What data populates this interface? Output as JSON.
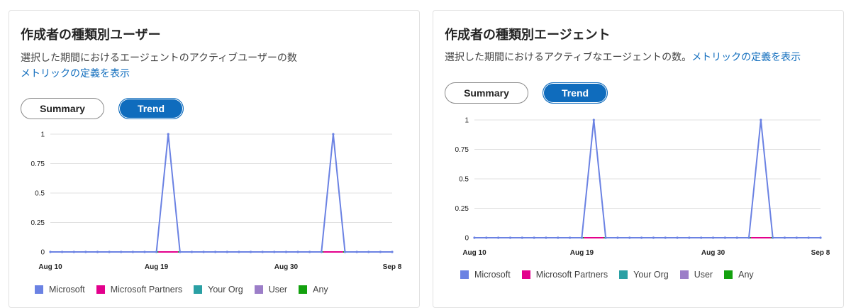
{
  "cards": [
    {
      "title": "作成者の種類別ユーザー",
      "description": "選択した期間におけるエージェントのアクティブユーザーの数",
      "link": "メトリックの定義を表示",
      "summary_label": "Summary",
      "trend_label": "Trend"
    },
    {
      "title": "作成者の種類別エージェント",
      "description": "選択した期間におけるアクティブなエージェントの数。",
      "link": "メトリックの定義を表示",
      "summary_label": "Summary",
      "trend_label": "Trend"
    }
  ],
  "legend": [
    {
      "name": "Microsoft",
      "color": "#6b82e3"
    },
    {
      "name": "Microsoft Partners",
      "color": "#e3008c"
    },
    {
      "name": "Your Org",
      "color": "#2aa0a4"
    },
    {
      "name": "User",
      "color": "#9c7ec8"
    },
    {
      "name": "Any",
      "color": "#13a10e"
    }
  ],
  "chart_data": [
    {
      "type": "line",
      "title": "作成者の種類別ユーザー",
      "x": [
        "Aug 10",
        "Aug 11",
        "Aug 12",
        "Aug 13",
        "Aug 14",
        "Aug 15",
        "Aug 16",
        "Aug 17",
        "Aug 18",
        "Aug 19",
        "Aug 20",
        "Aug 21",
        "Aug 22",
        "Aug 23",
        "Aug 24",
        "Aug 25",
        "Aug 26",
        "Aug 27",
        "Aug 28",
        "Aug 29",
        "Aug 30",
        "Aug 31",
        "Sep 1",
        "Sep 2",
        "Sep 3",
        "Sep 4",
        "Sep 5",
        "Sep 6",
        "Sep 7",
        "Sep 8"
      ],
      "x_tick_labels": [
        "Aug 10",
        "Aug 19",
        "Aug 30",
        "Sep 8"
      ],
      "y_ticks": [
        "0",
        "0.25",
        "0.5",
        "0.75",
        "1"
      ],
      "ylim": [
        0,
        1
      ],
      "series": [
        {
          "name": "Microsoft",
          "values": [
            0,
            0,
            0,
            0,
            0,
            0,
            0,
            0,
            0,
            0,
            1,
            0,
            0,
            0,
            0,
            0,
            0,
            0,
            0,
            0,
            0,
            0,
            0,
            0,
            1,
            0,
            0,
            0,
            0,
            0
          ]
        },
        {
          "name": "Microsoft Partners",
          "values": [
            0,
            0,
            0,
            0,
            0,
            0,
            0,
            0,
            0,
            0,
            0,
            0,
            0,
            0,
            0,
            0,
            0,
            0,
            0,
            0,
            0,
            0,
            0,
            0,
            0,
            0,
            0,
            0,
            0,
            0
          ]
        },
        {
          "name": "Your Org",
          "values": [
            0,
            0,
            0,
            0,
            0,
            0,
            0,
            0,
            0,
            0,
            0,
            0,
            0,
            0,
            0,
            0,
            0,
            0,
            0,
            0,
            0,
            0,
            0,
            0,
            0,
            0,
            0,
            0,
            0,
            0
          ]
        },
        {
          "name": "User",
          "values": [
            0,
            0,
            0,
            0,
            0,
            0,
            0,
            0,
            0,
            0,
            0,
            0,
            0,
            0,
            0,
            0,
            0,
            0,
            0,
            0,
            0,
            0,
            0,
            0,
            0,
            0,
            0,
            0,
            0,
            0
          ]
        },
        {
          "name": "Any",
          "values": [
            0,
            0,
            0,
            0,
            0,
            0,
            0,
            0,
            0,
            0,
            0,
            0,
            0,
            0,
            0,
            0,
            0,
            0,
            0,
            0,
            0,
            0,
            0,
            0,
            0,
            0,
            0,
            0,
            0,
            0
          ]
        }
      ],
      "grid": true,
      "legend_position": "bottom"
    },
    {
      "type": "line",
      "title": "作成者の種類別エージェント",
      "x": [
        "Aug 10",
        "Aug 11",
        "Aug 12",
        "Aug 13",
        "Aug 14",
        "Aug 15",
        "Aug 16",
        "Aug 17",
        "Aug 18",
        "Aug 19",
        "Aug 20",
        "Aug 21",
        "Aug 22",
        "Aug 23",
        "Aug 24",
        "Aug 25",
        "Aug 26",
        "Aug 27",
        "Aug 28",
        "Aug 29",
        "Aug 30",
        "Aug 31",
        "Sep 1",
        "Sep 2",
        "Sep 3",
        "Sep 4",
        "Sep 5",
        "Sep 6",
        "Sep 7",
        "Sep 8"
      ],
      "x_tick_labels": [
        "Aug 10",
        "Aug 19",
        "Aug 30",
        "Sep 8"
      ],
      "y_ticks": [
        "0",
        "0.25",
        "0.5",
        "0.75",
        "1"
      ],
      "ylim": [
        0,
        1
      ],
      "series": [
        {
          "name": "Microsoft",
          "values": [
            0,
            0,
            0,
            0,
            0,
            0,
            0,
            0,
            0,
            0,
            1,
            0,
            0,
            0,
            0,
            0,
            0,
            0,
            0,
            0,
            0,
            0,
            0,
            0,
            1,
            0,
            0,
            0,
            0,
            0
          ]
        },
        {
          "name": "Microsoft Partners",
          "values": [
            0,
            0,
            0,
            0,
            0,
            0,
            0,
            0,
            0,
            0,
            0,
            0,
            0,
            0,
            0,
            0,
            0,
            0,
            0,
            0,
            0,
            0,
            0,
            0,
            0,
            0,
            0,
            0,
            0,
            0
          ]
        },
        {
          "name": "Your Org",
          "values": [
            0,
            0,
            0,
            0,
            0,
            0,
            0,
            0,
            0,
            0,
            0,
            0,
            0,
            0,
            0,
            0,
            0,
            0,
            0,
            0,
            0,
            0,
            0,
            0,
            0,
            0,
            0,
            0,
            0,
            0
          ]
        },
        {
          "name": "User",
          "values": [
            0,
            0,
            0,
            0,
            0,
            0,
            0,
            0,
            0,
            0,
            0,
            0,
            0,
            0,
            0,
            0,
            0,
            0,
            0,
            0,
            0,
            0,
            0,
            0,
            0,
            0,
            0,
            0,
            0,
            0
          ]
        },
        {
          "name": "Any",
          "values": [
            0,
            0,
            0,
            0,
            0,
            0,
            0,
            0,
            0,
            0,
            0,
            0,
            0,
            0,
            0,
            0,
            0,
            0,
            0,
            0,
            0,
            0,
            0,
            0,
            0,
            0,
            0,
            0,
            0,
            0
          ]
        }
      ],
      "grid": true,
      "legend_position": "bottom"
    }
  ]
}
